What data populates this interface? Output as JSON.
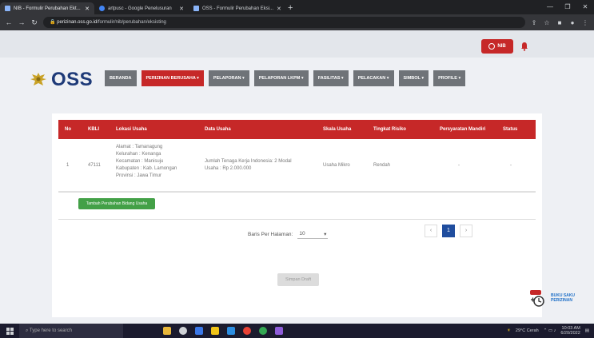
{
  "browser": {
    "tabs": [
      {
        "title": "NIB - Formulir Perubahan Ekt... ",
        "active": true
      },
      {
        "title": "artpusc - Google Penelusuran"
      },
      {
        "title": "OSS - Formulir Perubahan Eksi..."
      }
    ],
    "url_host": "perizinan.oss.go.id",
    "url_path": "/formulir/nib/perubahan/eksisting"
  },
  "header": {
    "user_label": "NIB",
    "logo_text": "OSS"
  },
  "menu": {
    "items": [
      {
        "label": "BERANDA",
        "active": false
      },
      {
        "label": "PERIZINAN BERUSAHA ▾",
        "active": true
      },
      {
        "label": "PELAPORAN ▾",
        "active": false
      },
      {
        "label": "PELAPORAN LKPM ▾",
        "active": false
      },
      {
        "label": "FASILITAS ▾",
        "active": false
      },
      {
        "label": "PELACAKAN ▾",
        "active": false
      },
      {
        "label": "SIMBOL ▾",
        "active": false
      },
      {
        "label": "PROFILE ▾",
        "active": false
      }
    ]
  },
  "table": {
    "headers": [
      "No",
      "KBLI",
      "Lokasi Usaha",
      "Data Usaha",
      "Skala Usaha",
      "Tingkat Risiko",
      "Persyaratan Mandiri",
      "Status"
    ],
    "rows": [
      {
        "no": "1",
        "kbli": "47111",
        "lokasi": "Alamat : Tamanagung Kelurahan : Kenanga Kecamatan : Manisuju Kabupaten : Kab. Lamongan Provinsi : Jawa Timur",
        "data": "Jumlah Tenaga Kerja Indonesia: 2 Modal Usaha : Rp 2.000.000",
        "skala": "Usaha Mikro",
        "risiko": "Rendah",
        "persyaratan": "-",
        "status": "-"
      }
    ],
    "add_button": "Tambah Perubahan Bidang Usaha"
  },
  "pagination": {
    "per_page_label": "Baris Per Halaman:",
    "per_page_value": "10",
    "prev": "‹",
    "current": "1",
    "next": "›"
  },
  "save_button": "Simpan Draft",
  "helper": {
    "line1": "BUKU SAKU",
    "line2": "PERIZINAN"
  },
  "taskbar": {
    "search_placeholder": "Type here to search",
    "weather": "29°C Cerah",
    "time": "10:03 AM",
    "date": "6/20/2022"
  },
  "colors": {
    "brand_red": "#c62828",
    "menu_grey": "#6f7378",
    "pager_blue": "#1f4d9e",
    "action_green": "#43a047"
  }
}
